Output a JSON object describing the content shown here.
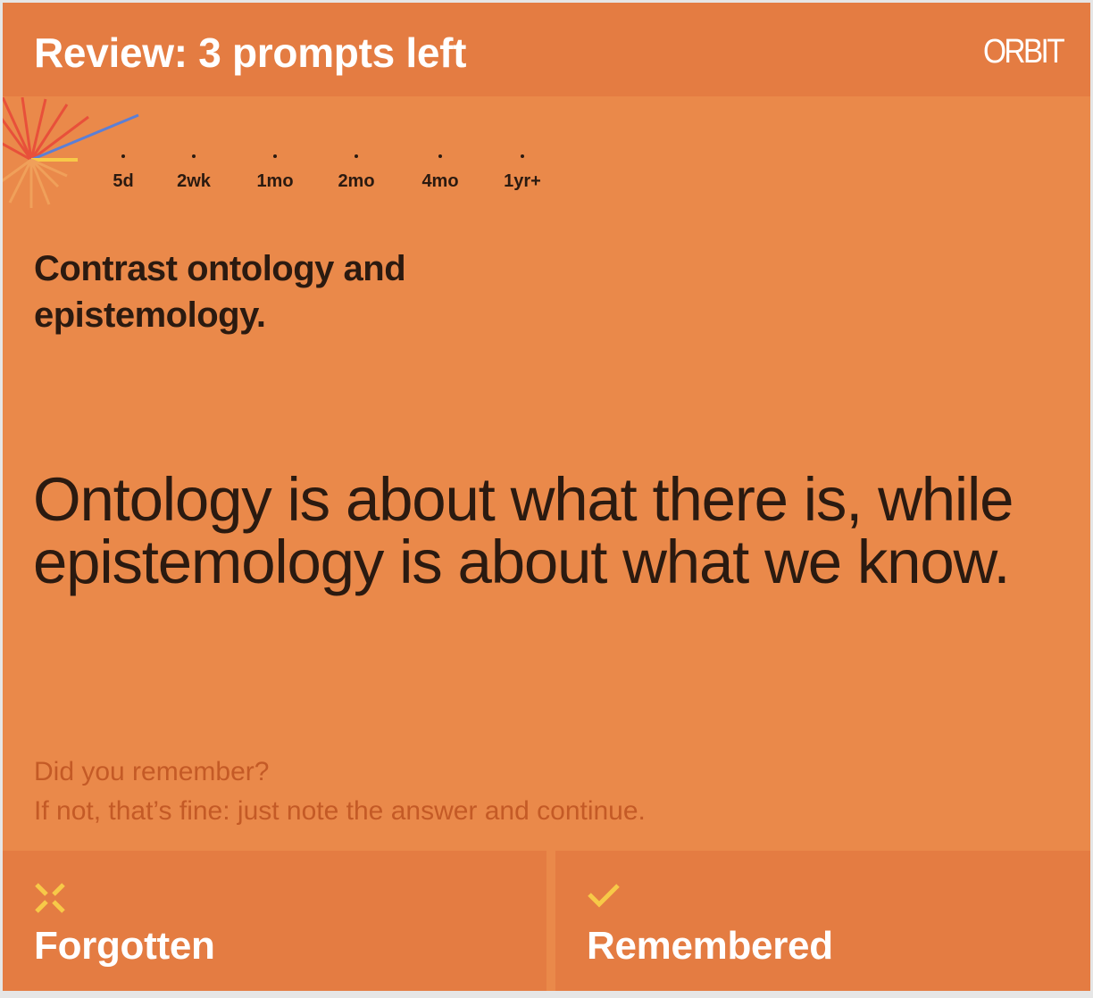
{
  "header": {
    "title": "Review: 3 prompts left",
    "logo_text": "ORBIT"
  },
  "timeline": {
    "intervals": [
      "5d",
      "2wk",
      "1mo",
      "2mo",
      "4mo",
      "1yr+"
    ]
  },
  "prompt": {
    "question": "Contrast ontology and epistemology.",
    "answer": "Ontology is about what there is, while epistemology is about what we know."
  },
  "hint": {
    "line1": "Did you remember?",
    "line2": "If not, that’s fine: just note the answer and continue."
  },
  "actions": {
    "forgotten_label": "Forgotten",
    "remembered_label": "Remembered"
  },
  "colors": {
    "background": "#ea894a",
    "header_bg": "#e47c42",
    "button_bg": "#e47c42",
    "text_dark": "#2b1a10",
    "hint_text": "#c45a26",
    "accent_yellow": "#f7c948",
    "accent_red": "#e8503a",
    "accent_blue": "#5b7fd6"
  },
  "icons": {
    "forgotten": "x-icon",
    "remembered": "check-icon",
    "progress": "starburst-icon"
  }
}
